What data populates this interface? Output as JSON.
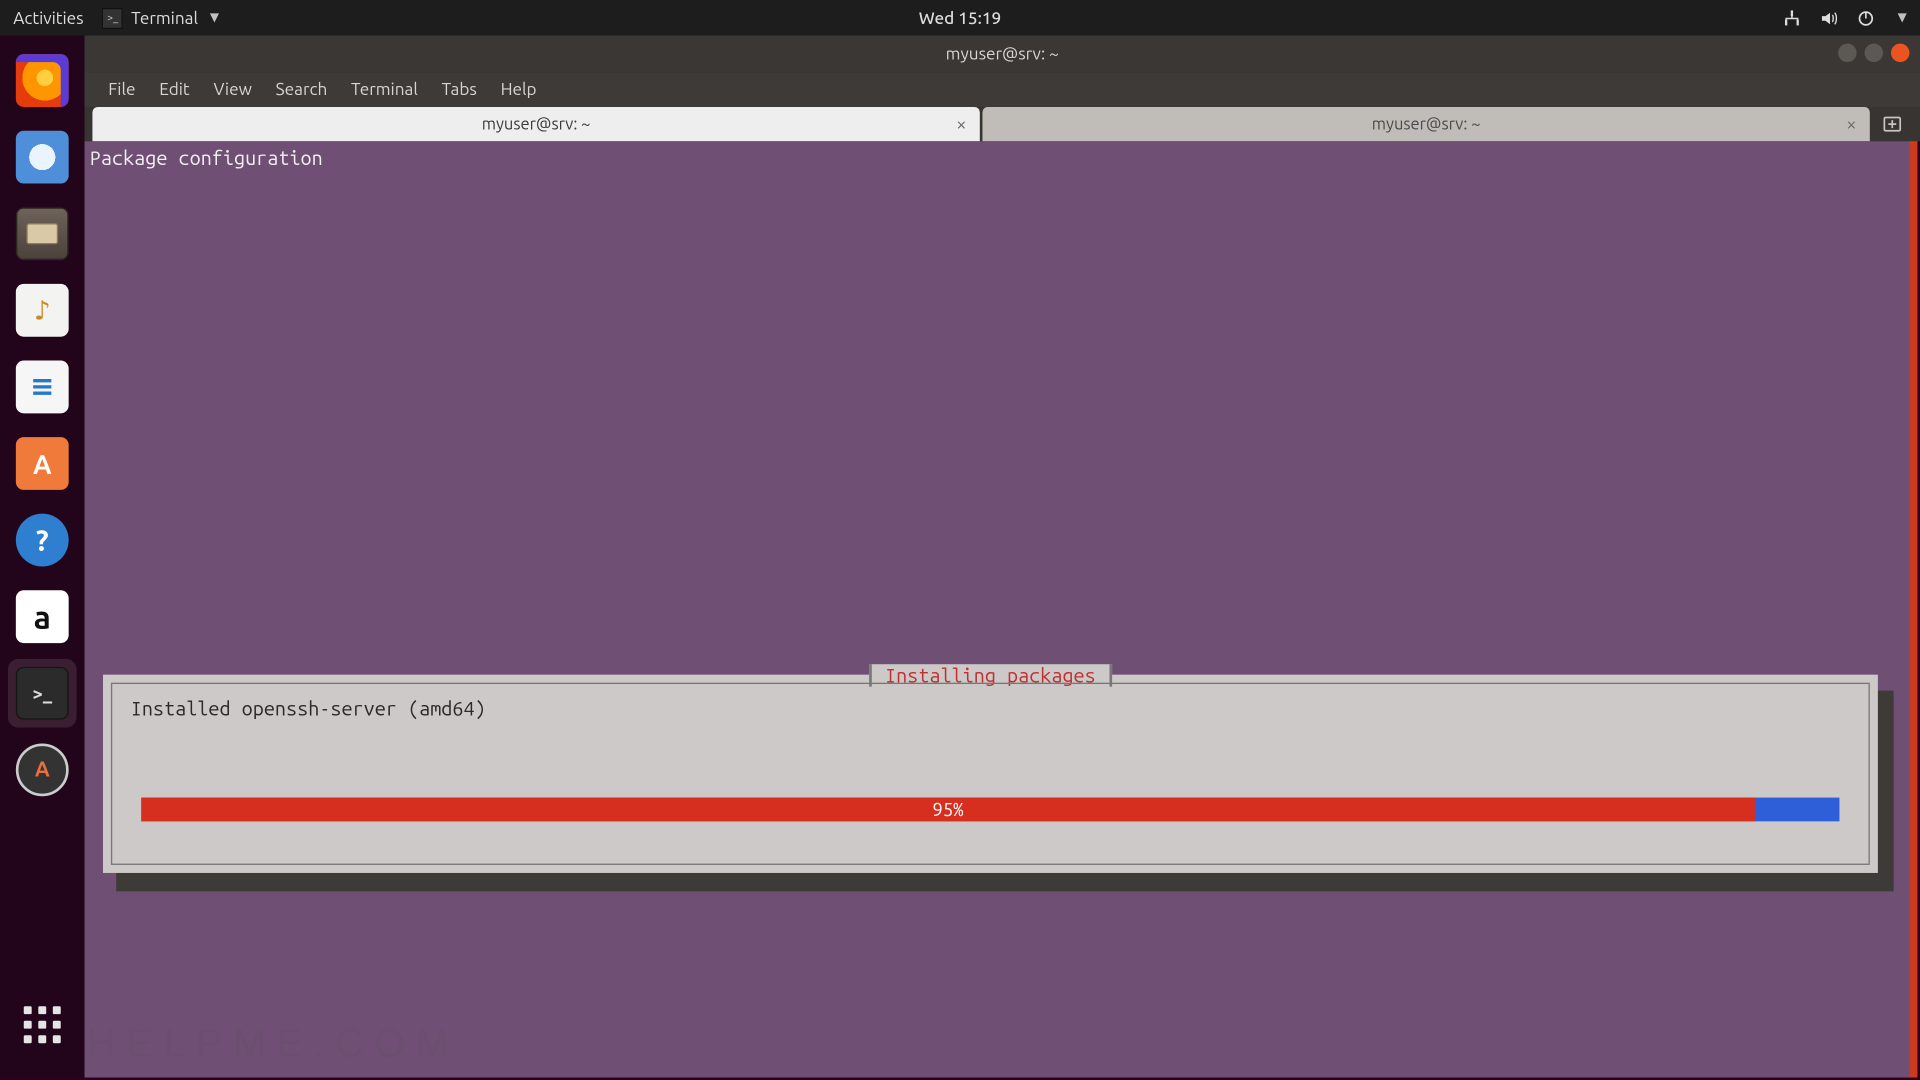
{
  "topbar": {
    "activities": "Activities",
    "app_name": "Terminal",
    "clock": "Wed 15:19"
  },
  "dock": {
    "items": [
      {
        "name": "firefox-icon"
      },
      {
        "name": "thunderbird-icon"
      },
      {
        "name": "files-icon"
      },
      {
        "name": "rhythmbox-icon"
      },
      {
        "name": "writer-icon"
      },
      {
        "name": "software-icon"
      },
      {
        "name": "help-icon"
      },
      {
        "name": "amazon-icon"
      },
      {
        "name": "terminal-icon"
      },
      {
        "name": "updater-icon"
      }
    ]
  },
  "window": {
    "title": "myuser@srv: ~",
    "menu": [
      "File",
      "Edit",
      "View",
      "Search",
      "Terminal",
      "Tabs",
      "Help"
    ],
    "tabs": [
      {
        "label": "myuser@srv: ~",
        "active": true
      },
      {
        "label": "myuser@srv: ~",
        "active": false
      }
    ]
  },
  "terminal": {
    "header_line": "Package configuration"
  },
  "dialog": {
    "title": "Installing packages",
    "status": "Installed openssh-server (amd64)",
    "progress_pct": 95,
    "progress_label": "95%"
  },
  "watermark": "HELPME.COM",
  "colors": {
    "term_bg": "#6f4f74",
    "progress_fill": "#d62f1f",
    "progress_bg": "#2e5fd9",
    "close_btn": "#e95420"
  }
}
